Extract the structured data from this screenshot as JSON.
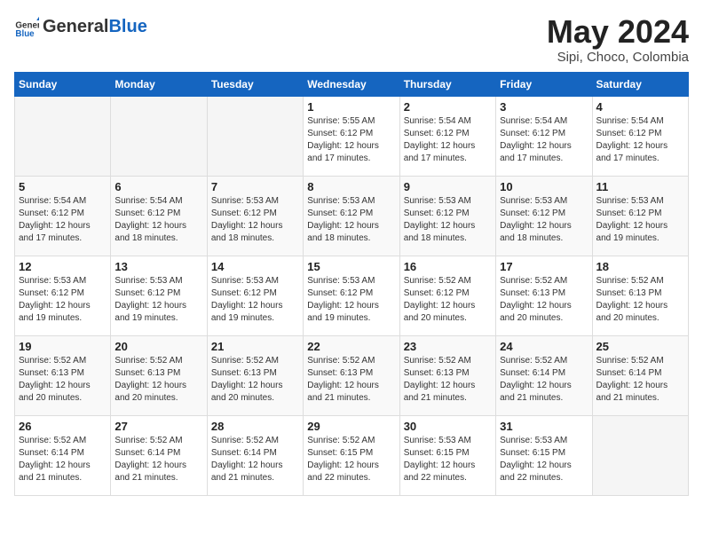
{
  "logo": {
    "general": "General",
    "blue": "Blue"
  },
  "title": "May 2024",
  "subtitle": "Sipi, Choco, Colombia",
  "days_of_week": [
    "Sunday",
    "Monday",
    "Tuesday",
    "Wednesday",
    "Thursday",
    "Friday",
    "Saturday"
  ],
  "weeks": [
    [
      {
        "day": "",
        "info": ""
      },
      {
        "day": "",
        "info": ""
      },
      {
        "day": "",
        "info": ""
      },
      {
        "day": "1",
        "info": "Sunrise: 5:55 AM\nSunset: 6:12 PM\nDaylight: 12 hours and 17 minutes."
      },
      {
        "day": "2",
        "info": "Sunrise: 5:54 AM\nSunset: 6:12 PM\nDaylight: 12 hours and 17 minutes."
      },
      {
        "day": "3",
        "info": "Sunrise: 5:54 AM\nSunset: 6:12 PM\nDaylight: 12 hours and 17 minutes."
      },
      {
        "day": "4",
        "info": "Sunrise: 5:54 AM\nSunset: 6:12 PM\nDaylight: 12 hours and 17 minutes."
      }
    ],
    [
      {
        "day": "5",
        "info": "Sunrise: 5:54 AM\nSunset: 6:12 PM\nDaylight: 12 hours and 17 minutes."
      },
      {
        "day": "6",
        "info": "Sunrise: 5:54 AM\nSunset: 6:12 PM\nDaylight: 12 hours and 18 minutes."
      },
      {
        "day": "7",
        "info": "Sunrise: 5:53 AM\nSunset: 6:12 PM\nDaylight: 12 hours and 18 minutes."
      },
      {
        "day": "8",
        "info": "Sunrise: 5:53 AM\nSunset: 6:12 PM\nDaylight: 12 hours and 18 minutes."
      },
      {
        "day": "9",
        "info": "Sunrise: 5:53 AM\nSunset: 6:12 PM\nDaylight: 12 hours and 18 minutes."
      },
      {
        "day": "10",
        "info": "Sunrise: 5:53 AM\nSunset: 6:12 PM\nDaylight: 12 hours and 18 minutes."
      },
      {
        "day": "11",
        "info": "Sunrise: 5:53 AM\nSunset: 6:12 PM\nDaylight: 12 hours and 19 minutes."
      }
    ],
    [
      {
        "day": "12",
        "info": "Sunrise: 5:53 AM\nSunset: 6:12 PM\nDaylight: 12 hours and 19 minutes."
      },
      {
        "day": "13",
        "info": "Sunrise: 5:53 AM\nSunset: 6:12 PM\nDaylight: 12 hours and 19 minutes."
      },
      {
        "day": "14",
        "info": "Sunrise: 5:53 AM\nSunset: 6:12 PM\nDaylight: 12 hours and 19 minutes."
      },
      {
        "day": "15",
        "info": "Sunrise: 5:53 AM\nSunset: 6:12 PM\nDaylight: 12 hours and 19 minutes."
      },
      {
        "day": "16",
        "info": "Sunrise: 5:52 AM\nSunset: 6:12 PM\nDaylight: 12 hours and 20 minutes."
      },
      {
        "day": "17",
        "info": "Sunrise: 5:52 AM\nSunset: 6:13 PM\nDaylight: 12 hours and 20 minutes."
      },
      {
        "day": "18",
        "info": "Sunrise: 5:52 AM\nSunset: 6:13 PM\nDaylight: 12 hours and 20 minutes."
      }
    ],
    [
      {
        "day": "19",
        "info": "Sunrise: 5:52 AM\nSunset: 6:13 PM\nDaylight: 12 hours and 20 minutes."
      },
      {
        "day": "20",
        "info": "Sunrise: 5:52 AM\nSunset: 6:13 PM\nDaylight: 12 hours and 20 minutes."
      },
      {
        "day": "21",
        "info": "Sunrise: 5:52 AM\nSunset: 6:13 PM\nDaylight: 12 hours and 20 minutes."
      },
      {
        "day": "22",
        "info": "Sunrise: 5:52 AM\nSunset: 6:13 PM\nDaylight: 12 hours and 21 minutes."
      },
      {
        "day": "23",
        "info": "Sunrise: 5:52 AM\nSunset: 6:13 PM\nDaylight: 12 hours and 21 minutes."
      },
      {
        "day": "24",
        "info": "Sunrise: 5:52 AM\nSunset: 6:14 PM\nDaylight: 12 hours and 21 minutes."
      },
      {
        "day": "25",
        "info": "Sunrise: 5:52 AM\nSunset: 6:14 PM\nDaylight: 12 hours and 21 minutes."
      }
    ],
    [
      {
        "day": "26",
        "info": "Sunrise: 5:52 AM\nSunset: 6:14 PM\nDaylight: 12 hours and 21 minutes."
      },
      {
        "day": "27",
        "info": "Sunrise: 5:52 AM\nSunset: 6:14 PM\nDaylight: 12 hours and 21 minutes."
      },
      {
        "day": "28",
        "info": "Sunrise: 5:52 AM\nSunset: 6:14 PM\nDaylight: 12 hours and 21 minutes."
      },
      {
        "day": "29",
        "info": "Sunrise: 5:52 AM\nSunset: 6:15 PM\nDaylight: 12 hours and 22 minutes."
      },
      {
        "day": "30",
        "info": "Sunrise: 5:53 AM\nSunset: 6:15 PM\nDaylight: 12 hours and 22 minutes."
      },
      {
        "day": "31",
        "info": "Sunrise: 5:53 AM\nSunset: 6:15 PM\nDaylight: 12 hours and 22 minutes."
      },
      {
        "day": "",
        "info": ""
      }
    ]
  ]
}
